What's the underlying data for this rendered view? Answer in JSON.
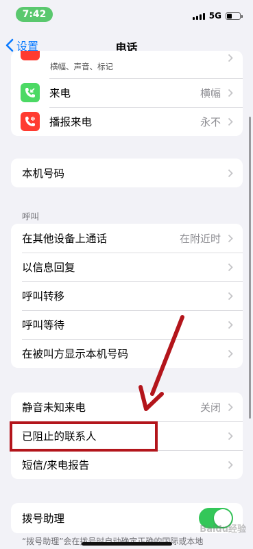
{
  "status": {
    "time": "7:42",
    "network": "5G",
    "battery_level": 0.35
  },
  "nav": {
    "back_label": "设置",
    "title": "电话"
  },
  "top_group": {
    "partial_subtitle": "横幅、声音、标记",
    "items": [
      {
        "label": "来电",
        "value": "横幅",
        "icon": "incoming-call-icon",
        "color": "#4cd964"
      },
      {
        "label": "播报来电",
        "value": "永不",
        "icon": "announce-calls-icon",
        "color": "#ff3b30"
      }
    ]
  },
  "my_number": {
    "label": "本机号码"
  },
  "calls": {
    "header": "呼叫",
    "items": [
      {
        "label": "在其他设备上通话",
        "value": "在附近时"
      },
      {
        "label": "以信息回复",
        "value": ""
      },
      {
        "label": "呼叫转移",
        "value": ""
      },
      {
        "label": "呼叫等待",
        "value": ""
      },
      {
        "label": "在被叫方显示本机号码",
        "value": ""
      }
    ]
  },
  "blocking": {
    "items": [
      {
        "label": "静音未知来电",
        "value": "关闭"
      },
      {
        "label": "已阻止的联系人",
        "value": ""
      },
      {
        "label": "短信/来电报告",
        "value": ""
      }
    ]
  },
  "dial_assist": {
    "label": "拨号助理",
    "enabled": true,
    "note": "“拨号助理”会在拨号时自动确定正确的国际或本地"
  },
  "watermark": "Baidu经验",
  "colors": {
    "accent": "#0a7aff",
    "toggle_on": "#34c759",
    "annotation": "#b3151b"
  }
}
